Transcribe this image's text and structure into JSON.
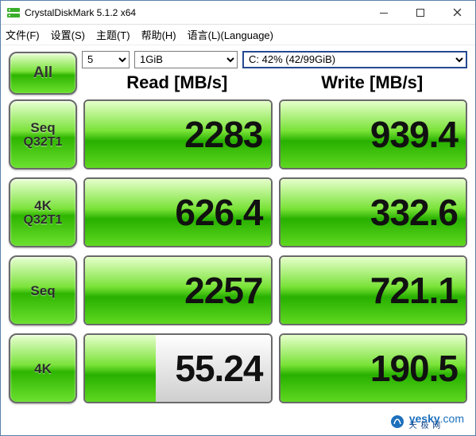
{
  "window": {
    "title": "CrystalDiskMark 5.1.2 x64"
  },
  "menu": {
    "file": "文件(F)",
    "settings": "设置(S)",
    "theme": "主题(T)",
    "help": "帮助(H)",
    "language": "语言(L)(Language)"
  },
  "controls": {
    "count": "5",
    "size": "1GiB",
    "drive": "C: 42% (42/99GiB)"
  },
  "buttons": {
    "all": "All",
    "seqq32t1_a": "Seq",
    "seqq32t1_b": "Q32T1",
    "fourkq32t1_a": "4K",
    "fourkq32t1_b": "Q32T1",
    "seq": "Seq",
    "fourk": "4K"
  },
  "headers": {
    "read": "Read [MB/s]",
    "write": "Write [MB/s]"
  },
  "results": {
    "seqq32t1": {
      "read": "2283",
      "write": "939.4",
      "read_fill": 100,
      "write_fill": 100
    },
    "fourkq32t1": {
      "read": "626.4",
      "write": "332.6",
      "read_fill": 100,
      "write_fill": 100
    },
    "seq": {
      "read": "2257",
      "write": "721.1",
      "read_fill": 100,
      "write_fill": 100
    },
    "fourk": {
      "read": "55.24",
      "write": "190.5",
      "read_fill": 38,
      "write_fill": 100
    }
  },
  "watermark": {
    "text": "yesky",
    "ext": ".com",
    "sub": "天 极 网"
  }
}
